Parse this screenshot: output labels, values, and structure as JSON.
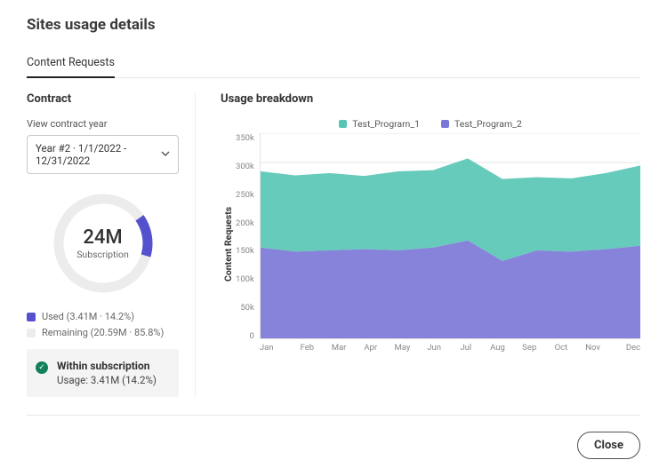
{
  "page_title": "Sites usage details",
  "tabs": {
    "content_requests": "Content Requests"
  },
  "contract": {
    "heading": "Contract",
    "year_label": "View contract year",
    "year_select": "Year #2  ·  1/1/2022 - 12/31/2022",
    "donut": {
      "value": "24M",
      "sub": "Subscription",
      "used_pct": 14.2
    },
    "legend": {
      "used": "Used (3.41M · 14.2%)",
      "remaining": "Remaining (20.59M · 85.8%)"
    },
    "status": {
      "title": "Within subscription",
      "detail": "Usage: 3.41M (14.2%)"
    }
  },
  "breakdown_heading": "Usage breakdown",
  "chart_legend": {
    "s1": "Test_Program_1",
    "s2": "Test_Program_2"
  },
  "yaxis_label": "Content Requests",
  "yticks": [
    "350k",
    "300k",
    "250k",
    "200k",
    "150k",
    "100k",
    "50k",
    "0"
  ],
  "xticks": [
    "Jan",
    "Feb",
    "Mar",
    "Apr",
    "May",
    "Jun",
    "Jul",
    "Aug",
    "Sep",
    "Oct",
    "Nov",
    "Dec"
  ],
  "footer": {
    "close": "Close"
  },
  "colors": {
    "series1": "#57C5B5",
    "series2": "#7A76D7",
    "grid": "#e6e6e6",
    "donut_track": "#ececec",
    "donut_used": "#5451cf",
    "status_check": "#12805c"
  },
  "chart_data": {
    "type": "area",
    "stacked": true,
    "categories": [
      "Jan",
      "Feb",
      "Mar",
      "Apr",
      "May",
      "Jun",
      "Jul",
      "Aug",
      "Sep",
      "Oct",
      "Nov",
      "Dec"
    ],
    "series": [
      {
        "name": "Test_Program_2",
        "color": "#7A76D7",
        "values": [
          155000,
          148000,
          150000,
          152000,
          150000,
          155000,
          167000,
          132000,
          150000,
          148000,
          152000,
          158000
        ]
      },
      {
        "name": "Test_Program_1",
        "color": "#57C5B5",
        "values": [
          130000,
          130000,
          132000,
          125000,
          135000,
          132000,
          140000,
          140000,
          125000,
          125000,
          130000,
          137000
        ]
      }
    ],
    "total_top": [
      285000,
      278000,
      282000,
      277000,
      285000,
      287000,
      307000,
      272000,
      275000,
      273000,
      282000,
      295000
    ],
    "ylabel": "Content Requests",
    "ylim": [
      0,
      350000
    ],
    "yticks": [
      0,
      50000,
      100000,
      150000,
      200000,
      250000,
      300000,
      350000
    ],
    "title": "Usage breakdown"
  }
}
